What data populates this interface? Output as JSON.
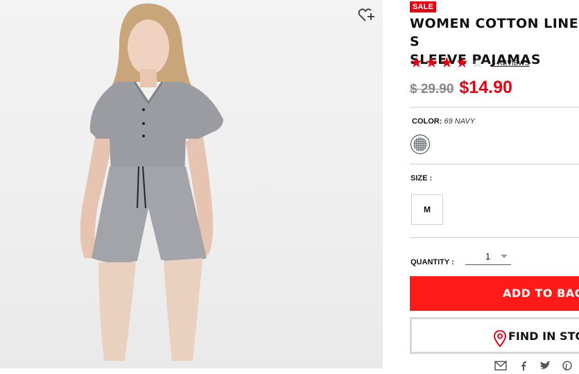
{
  "product": {
    "sale_badge": "SALE",
    "title": "WOMEN COTTON LINEN S\nSLEEVE PAJAMAS",
    "rating": 4,
    "max_rating": 5,
    "reviews_link": "5 REVIEWS",
    "original_price": "$ 29.90",
    "sale_price": "$14.90",
    "image_icon": "model-photo"
  },
  "colors": {
    "accent": "#e60012",
    "button_red": "#ff1a1a"
  },
  "color_option": {
    "label": "COLOR:",
    "value": "69 NAVY",
    "swatch_icon": "gingham-swatch"
  },
  "size_option": {
    "label": "SIZE :",
    "sizes": [
      "M"
    ]
  },
  "quantity": {
    "label": "QUANTITY :",
    "value": "1"
  },
  "actions": {
    "add_to_bag": "ADD TO BAG",
    "find_in_store": "FIND IN STORE",
    "wishlist_icon": "heart-plus-icon",
    "store_icon": "location-pin-icon"
  },
  "share_icons": [
    "mail-icon",
    "facebook-icon",
    "twitter-icon",
    "pinterest-icon"
  ]
}
